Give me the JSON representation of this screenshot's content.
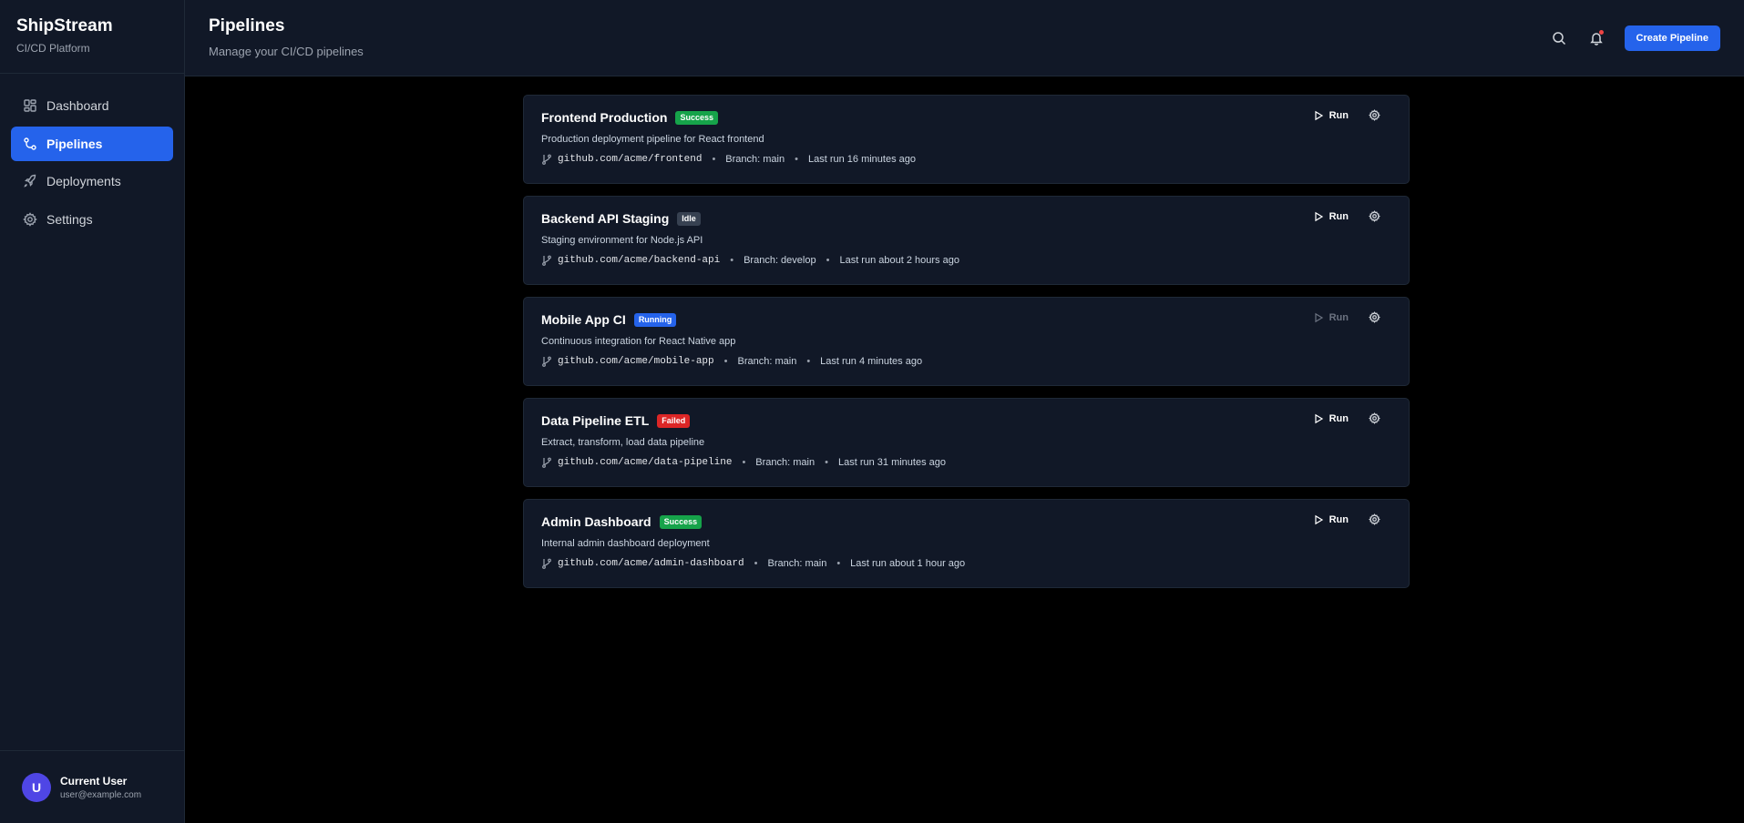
{
  "brand": {
    "name": "ShipStream",
    "subtitle": "CI/CD Platform"
  },
  "nav": [
    {
      "label": "Dashboard",
      "icon": "grid-icon",
      "active": false
    },
    {
      "label": "Pipelines",
      "icon": "pipeline-icon",
      "active": true
    },
    {
      "label": "Deployments",
      "icon": "rocket-icon",
      "active": false
    },
    {
      "label": "Settings",
      "icon": "gear-icon",
      "active": false
    }
  ],
  "user": {
    "initial": "U",
    "name": "Current User",
    "email": "user@example.com"
  },
  "header": {
    "title": "Pipelines",
    "subtitle": "Manage your CI/CD pipelines",
    "create_label": "Create Pipeline"
  },
  "colors": {
    "accent": "#2563eb",
    "success": "#16a34a",
    "idle": "#374151",
    "running": "#2563eb",
    "failed": "#dc2626",
    "notification": "#ef4444"
  },
  "pipelines": [
    {
      "name": "Frontend Production",
      "status": "Success",
      "status_color": "#16a34a",
      "description": "Production deployment pipeline for React frontend",
      "repo": "github.com/acme/frontend",
      "branch": "Branch: main",
      "last_run": "Last run 16 minutes ago",
      "run_label": "Run",
      "run_disabled": false
    },
    {
      "name": "Backend API Staging",
      "status": "Idle",
      "status_color": "#374151",
      "description": "Staging environment for Node.js API",
      "repo": "github.com/acme/backend-api",
      "branch": "Branch: develop",
      "last_run": "Last run about 2 hours ago",
      "run_label": "Run",
      "run_disabled": false
    },
    {
      "name": "Mobile App CI",
      "status": "Running",
      "status_color": "#2563eb",
      "description": "Continuous integration for React Native app",
      "repo": "github.com/acme/mobile-app",
      "branch": "Branch: main",
      "last_run": "Last run 4 minutes ago",
      "run_label": "Run",
      "run_disabled": true
    },
    {
      "name": "Data Pipeline ETL",
      "status": "Failed",
      "status_color": "#dc2626",
      "description": "Extract, transform, load data pipeline",
      "repo": "github.com/acme/data-pipeline",
      "branch": "Branch: main",
      "last_run": "Last run 31 minutes ago",
      "run_label": "Run",
      "run_disabled": false
    },
    {
      "name": "Admin Dashboard",
      "status": "Success",
      "status_color": "#16a34a",
      "description": "Internal admin dashboard deployment",
      "repo": "github.com/acme/admin-dashboard",
      "branch": "Branch: main",
      "last_run": "Last run about 1 hour ago",
      "run_label": "Run",
      "run_disabled": false
    }
  ]
}
